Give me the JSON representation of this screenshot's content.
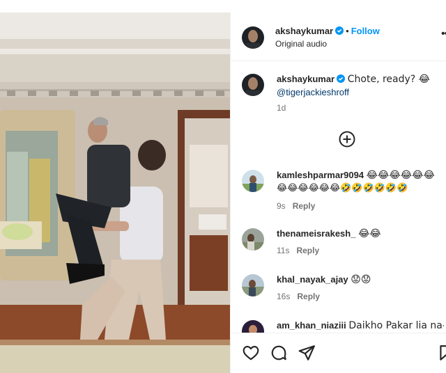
{
  "post": {
    "author": "akshaykumar",
    "audio": "Original audio",
    "follow_label": "Follow",
    "dot": "•",
    "caption_text": "Chote, ready? 😂",
    "caption_mention": "@tigerjackieshroff",
    "caption_time": "1d",
    "load_more_icon": "plus-circle-icon"
  },
  "comments": [
    {
      "user": "kamleshparmar9094",
      "line1": "😂😂😂😂😂😂",
      "line2": "😂😂😂😂😂😂🤣🤣🤣🤣🤣🤣",
      "time": "9s",
      "reply": "Reply"
    },
    {
      "user": "thenameisrakesh_",
      "line1": "😂😂",
      "time": "11s",
      "reply": "Reply"
    },
    {
      "user": "khal_nayak_ajay",
      "line1": "😟😟",
      "time": "16s",
      "reply": "Reply"
    },
    {
      "user": "am_khan_niaziii",
      "line1": "Daikho Pakar lia na😂",
      "time": "",
      "reply": ""
    }
  ],
  "icons": {
    "like": "heart-icon",
    "comment": "comment-icon",
    "share": "send-icon",
    "save": "bookmark-icon",
    "verified": "verified-badge-icon",
    "more": "more-options-icon"
  },
  "colors": {
    "accent": "#0095f6",
    "verified": "#0095f6",
    "muted": "#737373",
    "mention": "#00376b"
  }
}
